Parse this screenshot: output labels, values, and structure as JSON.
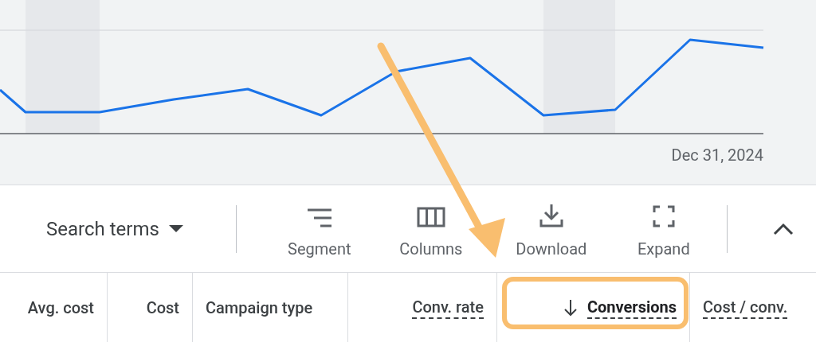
{
  "chart": {
    "x_label": "Dec 31, 2024"
  },
  "toolbar": {
    "view_selector": {
      "label": "Search terms"
    },
    "tools": [
      {
        "kind": "segment",
        "label": "Segment"
      },
      {
        "kind": "columns",
        "label": "Columns"
      },
      {
        "kind": "download",
        "label": "Download"
      },
      {
        "kind": "expand",
        "label": "Expand"
      }
    ],
    "collapse": {
      "expanded": true
    }
  },
  "table": {
    "columns": [
      {
        "label": "Avg. cost",
        "right_aligned": true,
        "dashed": false,
        "sorted": false
      },
      {
        "label": "Cost",
        "right_aligned": true,
        "dashed": false,
        "sorted": false
      },
      {
        "label": "Campaign type",
        "right_aligned": false,
        "dashed": false,
        "sorted": false
      },
      {
        "label": "Conv. rate",
        "right_aligned": true,
        "dashed": true,
        "sorted": false
      },
      {
        "label": "Conversions",
        "right_aligned": true,
        "dashed": true,
        "sorted": true
      },
      {
        "label": "Cost / conv.",
        "right_aligned": false,
        "dashed": true,
        "sorted": false
      }
    ]
  }
}
